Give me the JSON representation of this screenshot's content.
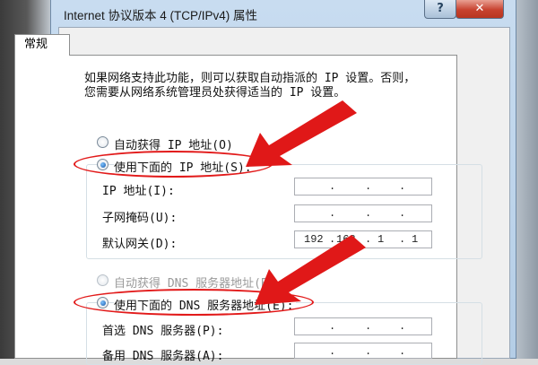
{
  "window": {
    "title": "Internet 协议版本 4 (TCP/IPv4) 属性",
    "help_label": "?",
    "close_label": "✕"
  },
  "tabs": [
    {
      "label": "常规",
      "active": true
    }
  ],
  "description": {
    "line1": "如果网络支持此功能，则可以获取自动指派的 IP 设置。否则，",
    "line2": "您需要从网络系统管理员处获得适当的 IP 设置。"
  },
  "ip": {
    "auto_option": {
      "label": "自动获得 IP 地址(O)",
      "selected": false
    },
    "manual_option": {
      "label": "使用下面的 IP 地址(S):",
      "selected": true
    },
    "fields": [
      {
        "label": "IP 地址(I):",
        "octets": [
          "",
          "",
          "",
          ""
        ]
      },
      {
        "label": "子网掩码(U):",
        "octets": [
          "",
          "",
          "",
          ""
        ]
      },
      {
        "label": "默认网关(D):",
        "octets": [
          "192",
          "168",
          "1",
          "1"
        ]
      }
    ]
  },
  "dns": {
    "auto_option": {
      "label": "自动获得 DNS 服务器地址(B)",
      "selected": false,
      "disabled": true
    },
    "manual_option": {
      "label": "使用下面的 DNS 服务器地址(E):",
      "selected": true
    },
    "fields": [
      {
        "label": "首选 DNS 服务器(P):",
        "octets": [
          "",
          "",
          "",
          ""
        ]
      },
      {
        "label": "备用 DNS 服务器(A):",
        "octets": [
          "",
          "",
          "",
          ""
        ]
      }
    ]
  },
  "annotation": {
    "color": "#e21a1a",
    "arrow_icon": "red-arrow-icon"
  }
}
